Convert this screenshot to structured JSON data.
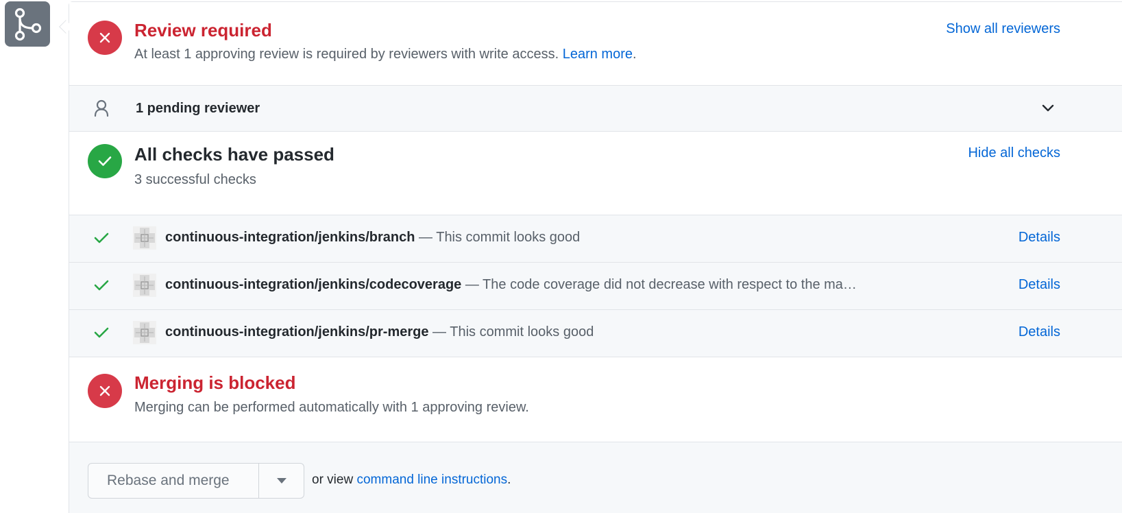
{
  "review": {
    "title": "Review required",
    "description": "At least 1 approving review is required by reviewers with write access.",
    "learn_more": "Learn more",
    "learn_more_suffix": ".",
    "show_all": "Show all reviewers"
  },
  "pending": {
    "label": "1 pending reviewer"
  },
  "checks": {
    "title": "All checks have passed",
    "subtitle": "3 successful checks",
    "hide_all": "Hide all checks",
    "items": [
      {
        "name": "continuous-integration/jenkins/branch",
        "desc": " — This commit looks good",
        "details": "Details"
      },
      {
        "name": "continuous-integration/jenkins/codecoverage",
        "desc": " — The code coverage did not decrease with respect to the ma…",
        "details": "Details"
      },
      {
        "name": "continuous-integration/jenkins/pr-merge",
        "desc": " — This commit looks good",
        "details": "Details"
      }
    ]
  },
  "blocked": {
    "title": "Merging is blocked",
    "description": "Merging can be performed automatically with 1 approving review."
  },
  "merge": {
    "button_label": "Rebase and merge",
    "or_view": "or view ",
    "cli_link": "command line instructions",
    "suffix": "."
  },
  "colors": {
    "error": "#d73a49",
    "success": "#28a745",
    "link": "#0366d6"
  }
}
